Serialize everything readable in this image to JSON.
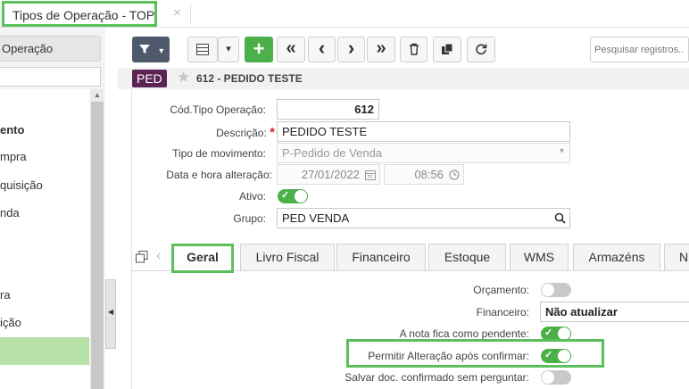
{
  "top_tab": {
    "title": "Tipos de Operação - TOP",
    "close": "×"
  },
  "sidebar": {
    "button_label": "Operação",
    "items": [
      {
        "label": "ento",
        "bold": true
      },
      {
        "label": "mpra",
        "bold": false
      },
      {
        "label": "quisição",
        "bold": false
      },
      {
        "label": "nda",
        "bold": false
      },
      {
        "label": "ra",
        "bold": false
      },
      {
        "label": "ição",
        "bold": false
      }
    ],
    "collapse_arrow": "◀",
    "scroll_arrow": "▲"
  },
  "toolbar": {
    "filter_icon": "▼",
    "caret": "▾",
    "grid_icon": "▤",
    "add": "+",
    "first": "«",
    "prev": "‹",
    "next": "›",
    "last": "»",
    "delete_icon": "🗑",
    "copy_icon": "❐",
    "refresh_icon": "↻",
    "search_placeholder": "Pesquisar registros..."
  },
  "record": {
    "badge": "PED",
    "title": "612 - PEDIDO TESTE",
    "star": "★"
  },
  "form": {
    "cod_label": "Cód.Tipo Operação:",
    "cod_value": "612",
    "desc_label": "Descrição:",
    "desc_required": "*",
    "desc_value": "PEDIDO TESTE",
    "tipo_label": "Tipo de movimento:",
    "tipo_value": "P-Pedido de Venda",
    "data_label": "Data e hora alteração:",
    "data_value": "27/01/2022",
    "hora_value": "08:56",
    "ativo_label": "Ativo:",
    "ativo_on": true,
    "grupo_label": "Grupo:",
    "grupo_value": "PED VENDA"
  },
  "tabs": [
    "Geral",
    "Livro Fiscal",
    "Financeiro",
    "Estoque",
    "WMS",
    "Armazéns",
    "N"
  ],
  "geral": {
    "orcamento_label": "Orçamento:",
    "orcamento_on": false,
    "financeiro_label": "Financeiro:",
    "financeiro_value": "Não atualizar",
    "pendente_label": "A nota fica como pendente:",
    "pendente_on": true,
    "permitir_label": "Permitir Alteração após confirmar:",
    "permitir_on": true,
    "salvar_label": "Salvar doc. confirmado sem perguntar:",
    "salvar_on": false
  },
  "colors": {
    "highlight": "#5cc05a",
    "toggle_on": "#4cb04a",
    "badge": "#5b2455",
    "selected_row": "#b6e2a9"
  }
}
